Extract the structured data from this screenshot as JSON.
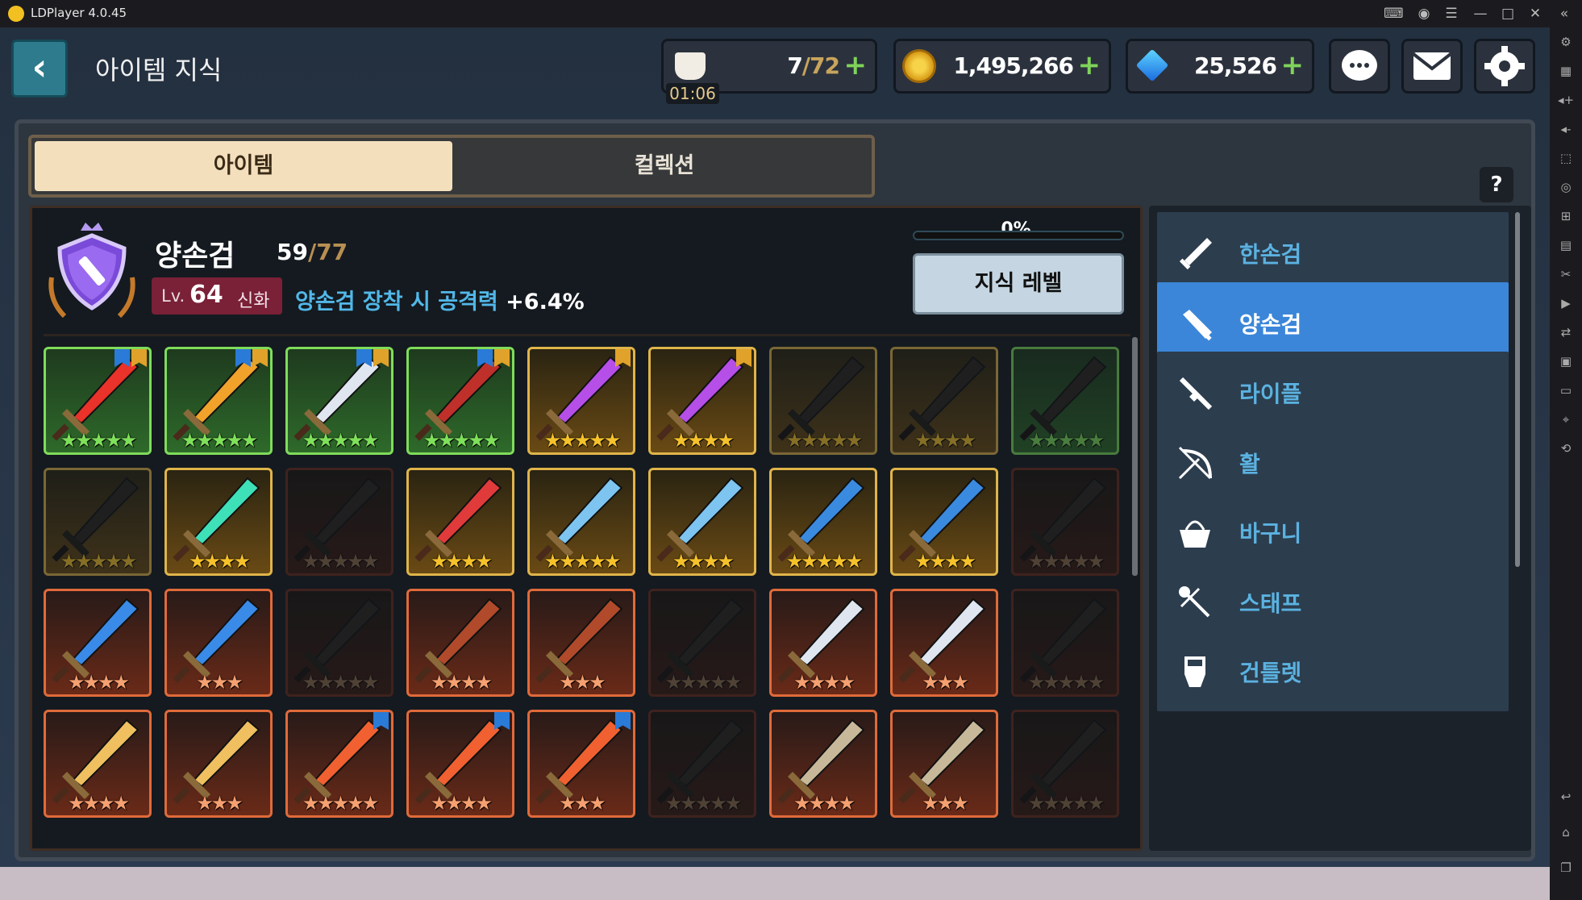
{
  "titlebar": {
    "app_title": "LDPlayer 4.0.45",
    "controls": [
      "gamepad-icon",
      "account-icon",
      "menu-icon",
      "minimize-icon",
      "maximize-icon",
      "close-icon",
      "collapse-icon"
    ]
  },
  "header": {
    "title": "아이템 지식",
    "stamina": {
      "current": "7",
      "max": "/72",
      "timer": "01:06"
    },
    "gold": "1,495,266",
    "gems": "25,526"
  },
  "tabs": {
    "item": "아이템",
    "collection": "컬렉션",
    "help": "?"
  },
  "weapon": {
    "name": "양손검",
    "collected": "59",
    "total": "/77",
    "lv_prefix": "Lv.",
    "level": "64",
    "grade": "신화",
    "effect_text": "양손검 장착 시 공격력",
    "effect_value": " +6.4%",
    "progress_text": "0%",
    "progress": 0,
    "knowledge_button": "지식 레벨"
  },
  "categories": [
    {
      "label": "한손검",
      "icon": "sword-icon"
    },
    {
      "label": "양손검",
      "icon": "greatsword-icon",
      "selected": true
    },
    {
      "label": "라이플",
      "icon": "rifle-icon"
    },
    {
      "label": "활",
      "icon": "bow-icon"
    },
    {
      "label": "바구니",
      "icon": "basket-icon"
    },
    {
      "label": "스태프",
      "icon": "staff-icon"
    },
    {
      "label": "건틀렛",
      "icon": "gauntlet-icon"
    }
  ],
  "items": [
    [
      {
        "r": "green",
        "s": 5,
        "o": true,
        "b": [
          "blue",
          "gold"
        ],
        "c": "#e8322a"
      },
      {
        "r": "green",
        "s": 5,
        "o": true,
        "b": [
          "blue",
          "gold"
        ],
        "c": "#f0a22a"
      },
      {
        "r": "green",
        "s": 5,
        "o": true,
        "b": [
          "blue",
          "gold"
        ],
        "c": "#e0e6f0"
      },
      {
        "r": "green",
        "s": 5,
        "o": true,
        "b": [
          "blue",
          "gold"
        ],
        "c": "#c0302a"
      },
      {
        "r": "gold",
        "s": 5,
        "o": true,
        "b": [
          "gold"
        ],
        "c": "#b64ee8"
      },
      {
        "r": "gold",
        "s": 4,
        "o": true,
        "b": [
          "gold"
        ],
        "c": "#b64ee8"
      },
      {
        "r": "gold",
        "s": 5,
        "o": false,
        "b": [],
        "c": "#9a4a1a"
      },
      {
        "r": "gold",
        "s": 4,
        "o": false,
        "b": [],
        "c": "#9a4a1a"
      },
      {
        "r": "green",
        "s": 5,
        "o": false,
        "b": [],
        "c": "#3a8a9a"
      }
    ],
    [
      {
        "r": "gold",
        "s": 5,
        "o": false,
        "b": [],
        "c": "#2f8a7a"
      },
      {
        "r": "gold",
        "s": 4,
        "o": true,
        "b": [],
        "c": "#3ee0b8"
      },
      {
        "r": "red",
        "s": 5,
        "o": false,
        "b": [],
        "c": "#8a2a2a"
      },
      {
        "r": "gold",
        "s": 4,
        "o": true,
        "b": [],
        "c": "#e03a3a"
      },
      {
        "r": "gold",
        "s": 5,
        "o": true,
        "b": [],
        "c": "#7ec4f0"
      },
      {
        "r": "gold",
        "s": 4,
        "o": true,
        "b": [],
        "c": "#7ec4f0"
      },
      {
        "r": "gold",
        "s": 5,
        "o": true,
        "b": [],
        "c": "#3a8ae0"
      },
      {
        "r": "gold",
        "s": 4,
        "o": true,
        "b": [],
        "c": "#3a8ae0"
      },
      {
        "r": "red",
        "s": 5,
        "o": false,
        "b": [],
        "c": "#3a5a9a"
      }
    ],
    [
      {
        "r": "orange",
        "s": 4,
        "o": true,
        "b": [],
        "c": "#3a8ae8"
      },
      {
        "r": "orange",
        "s": 3,
        "o": true,
        "b": [],
        "c": "#3a8ae8"
      },
      {
        "r": "red",
        "s": 5,
        "o": false,
        "b": [],
        "c": "#7a2a1a"
      },
      {
        "r": "orange",
        "s": 4,
        "o": true,
        "b": [],
        "c": "#b04a2a"
      },
      {
        "r": "orange",
        "s": 3,
        "o": true,
        "b": [],
        "c": "#b04a2a"
      },
      {
        "r": "red",
        "s": 5,
        "o": false,
        "b": [],
        "c": "#707070"
      },
      {
        "r": "orange",
        "s": 4,
        "o": true,
        "b": [],
        "c": "#dfe6f0"
      },
      {
        "r": "orange",
        "s": 3,
        "o": true,
        "b": [],
        "c": "#dfe6f0"
      },
      {
        "r": "red",
        "s": 5,
        "o": false,
        "b": [],
        "c": "#b08a4a"
      }
    ],
    [
      {
        "r": "orange",
        "s": 4,
        "o": true,
        "b": [],
        "c": "#f0c060"
      },
      {
        "r": "orange",
        "s": 3,
        "o": true,
        "b": [],
        "c": "#f0c060"
      },
      {
        "r": "orange",
        "s": 5,
        "o": true,
        "b": [
          "blue"
        ],
        "c": "#f06030"
      },
      {
        "r": "orange",
        "s": 4,
        "o": true,
        "b": [
          "blue"
        ],
        "c": "#f06030"
      },
      {
        "r": "orange",
        "s": 3,
        "o": true,
        "b": [
          "blue"
        ],
        "c": "#f06030"
      },
      {
        "r": "red",
        "s": 5,
        "o": false,
        "b": [],
        "c": "#6a6050"
      },
      {
        "r": "orange",
        "s": 4,
        "o": true,
        "b": [],
        "c": "#c8b89a"
      },
      {
        "r": "orange",
        "s": 3,
        "o": true,
        "b": [],
        "c": "#c8b89a"
      },
      {
        "r": "red",
        "s": 5,
        "o": false,
        "b": [],
        "c": "#4a4a3a"
      }
    ]
  ]
}
